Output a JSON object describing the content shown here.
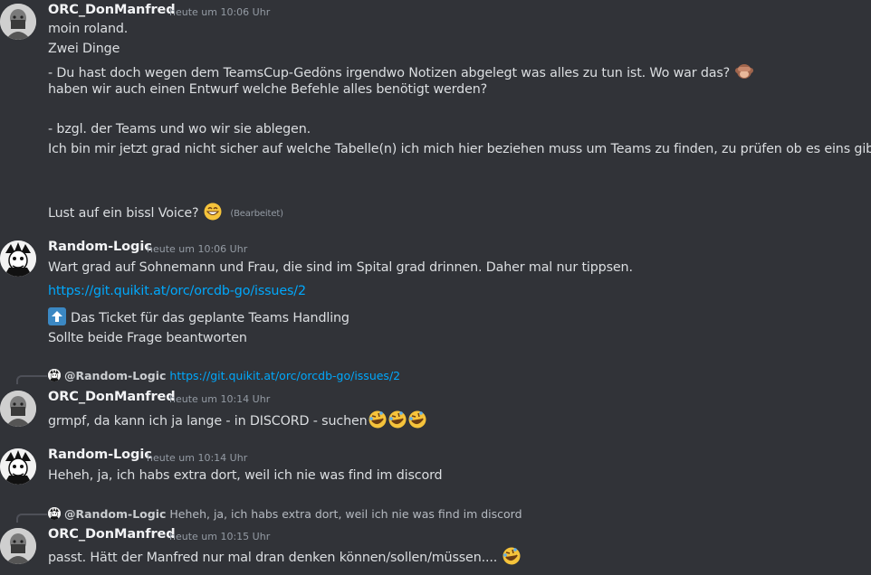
{
  "messages": [
    {
      "author": "ORC_DonManfred",
      "time": "heute um 10:06 Uhr",
      "lines": [
        "moin roland.",
        "Zwei Dinge",
        "- Du hast doch wegen dem TeamsCup-Gedöns irgendwo Notizen abgelegt was alles zu tun ist. Wo war das?",
        "haben wir auch einen Entwurf welche Befehle alles benötigt werden?",
        "- bzgl. der Teams und wo wir sie ablegen.",
        "Ich bin mir jetzt grad nicht sicher auf welche Tabelle(n) ich mich hier beziehen muss um Teams zu finden, zu prüfen ob es eins gibt.",
        "Lust auf ein bissl Voice?"
      ],
      "edited": "(Bearbeitet)"
    },
    {
      "author": "Random-Logic",
      "time": "heute um 10:06 Uhr",
      "lines": [
        "Wart grad auf Sohnemann und Frau, die sind im Spital grad drinnen. Daher mal nur tippsen.",
        "https://git.quikit.at/orc/orcdb-go/issues/2",
        "Das Ticket für das geplante Teams Handling",
        "Sollte beide Frage beantworten"
      ]
    },
    {
      "reply": {
        "author": "@Random-Logic",
        "text": "https://git.quikit.at/orc/orcdb-go/issues/2"
      },
      "author": "ORC_DonManfred",
      "time": "heute um 10:14 Uhr",
      "lines": [
        "grmpf, da kann ich ja lange - in DISCORD - suchen"
      ]
    },
    {
      "author": "Random-Logic",
      "time": "heute um 10:14 Uhr",
      "lines": [
        "Heheh, ja, ich habs extra dort, weil ich nie was find im discord"
      ]
    },
    {
      "reply": {
        "author": "@Random-Logic",
        "text": "Heheh, ja, ich habs extra dort, weil ich nie was find im discord"
      },
      "author": "ORC_DonManfred",
      "time": "heute um 10:15 Uhr",
      "lines": [
        "passt. Hätt der Manfred nur mal dran denken können/sollen/müssen...."
      ]
    }
  ],
  "emojis": {
    "see_no_evil": "see-no-evil-monkey-icon",
    "grin": "grinning-face-icon",
    "rofl": "rolling-on-floor-laughing-icon",
    "up": "up-arrow-icon"
  },
  "colors": {
    "background": "#313338",
    "text": "#dbdee1",
    "link": "#00a8fc",
    "timestamp": "#949ba4"
  }
}
